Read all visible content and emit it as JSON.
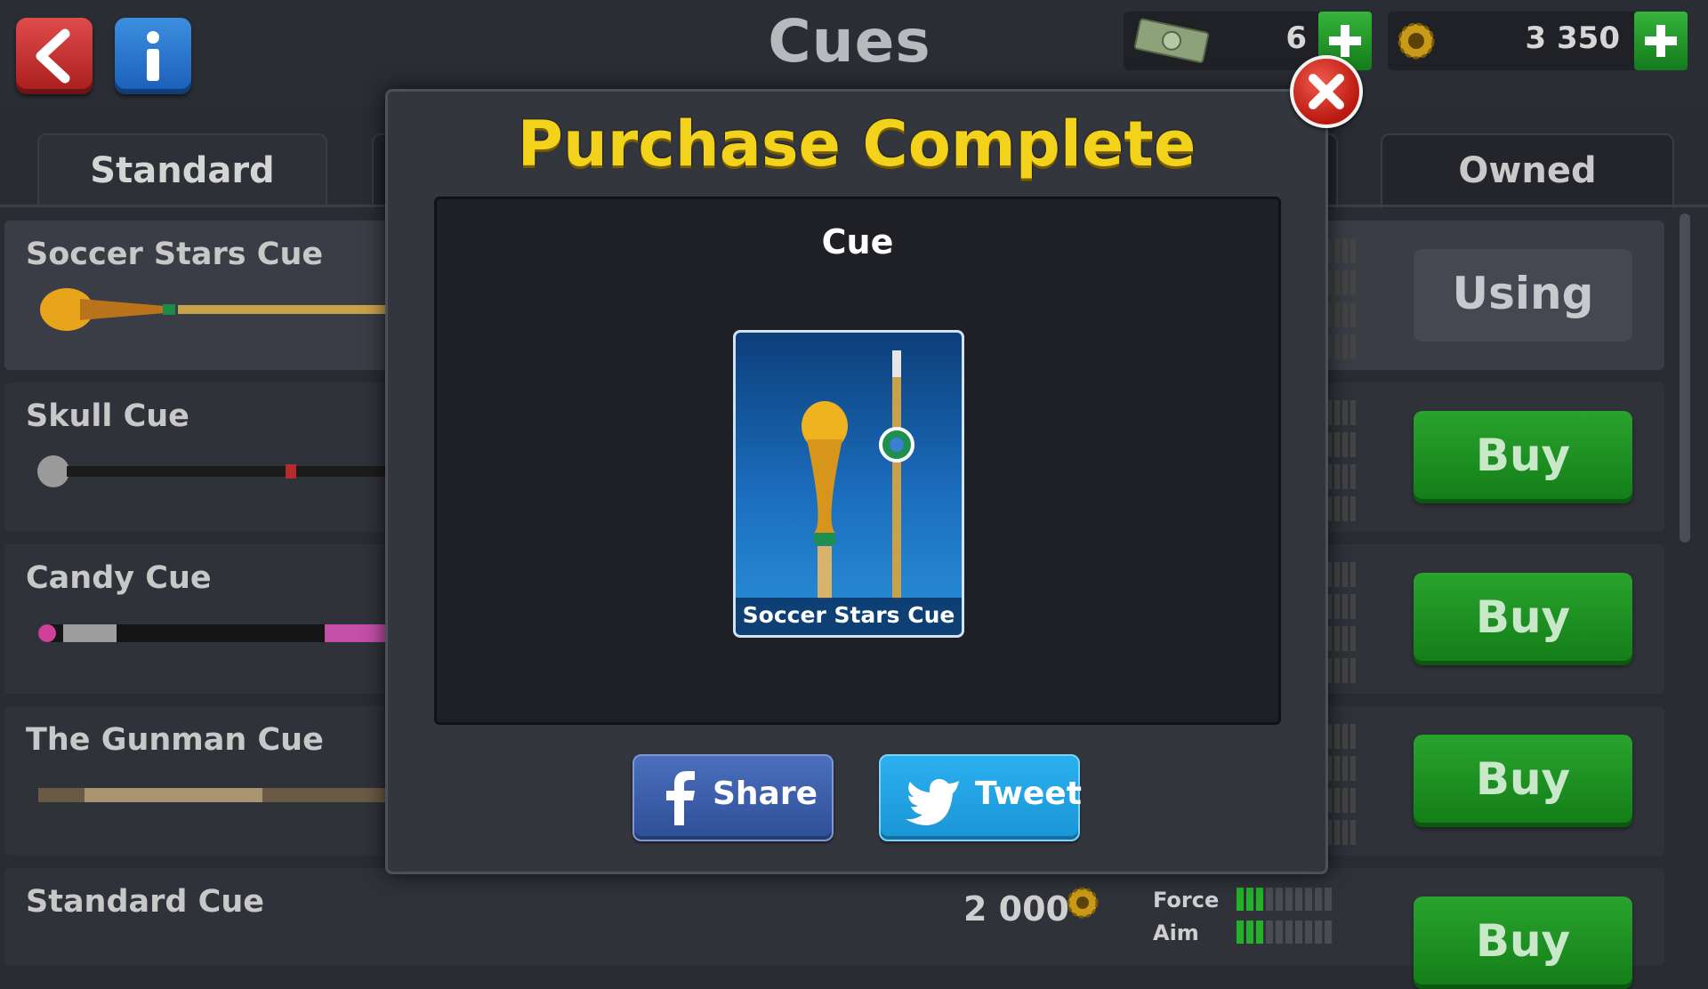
{
  "header": {
    "title": "Cues",
    "back_icon": "back-arrow-icon",
    "info_icon": "info-icon",
    "cash_amount": "6",
    "coin_amount": "3 350",
    "accent_green": "#1f9e25"
  },
  "tabs": [
    {
      "label": "Standard"
    },
    {
      "label": "Owned"
    }
  ],
  "cues": [
    {
      "name": "Soccer Stars Cue",
      "action": "Using"
    },
    {
      "name": "Skull Cue",
      "action": "Buy"
    },
    {
      "name": "Candy Cue",
      "action": "Buy"
    },
    {
      "name": "The Gunman Cue",
      "action": "Buy"
    },
    {
      "name": "Standard Cue",
      "action": "Buy",
      "price": "2 000",
      "force_label": "Force",
      "aim_label": "Aim",
      "force": 3,
      "aim": 3,
      "max": 10
    }
  ],
  "modal": {
    "title": "Purchase Complete",
    "heading": "Cue",
    "item_name": "Soccer Stars Cue",
    "share_label": "Share",
    "tweet_label": "Tweet",
    "title_color": "#f3d21b"
  }
}
